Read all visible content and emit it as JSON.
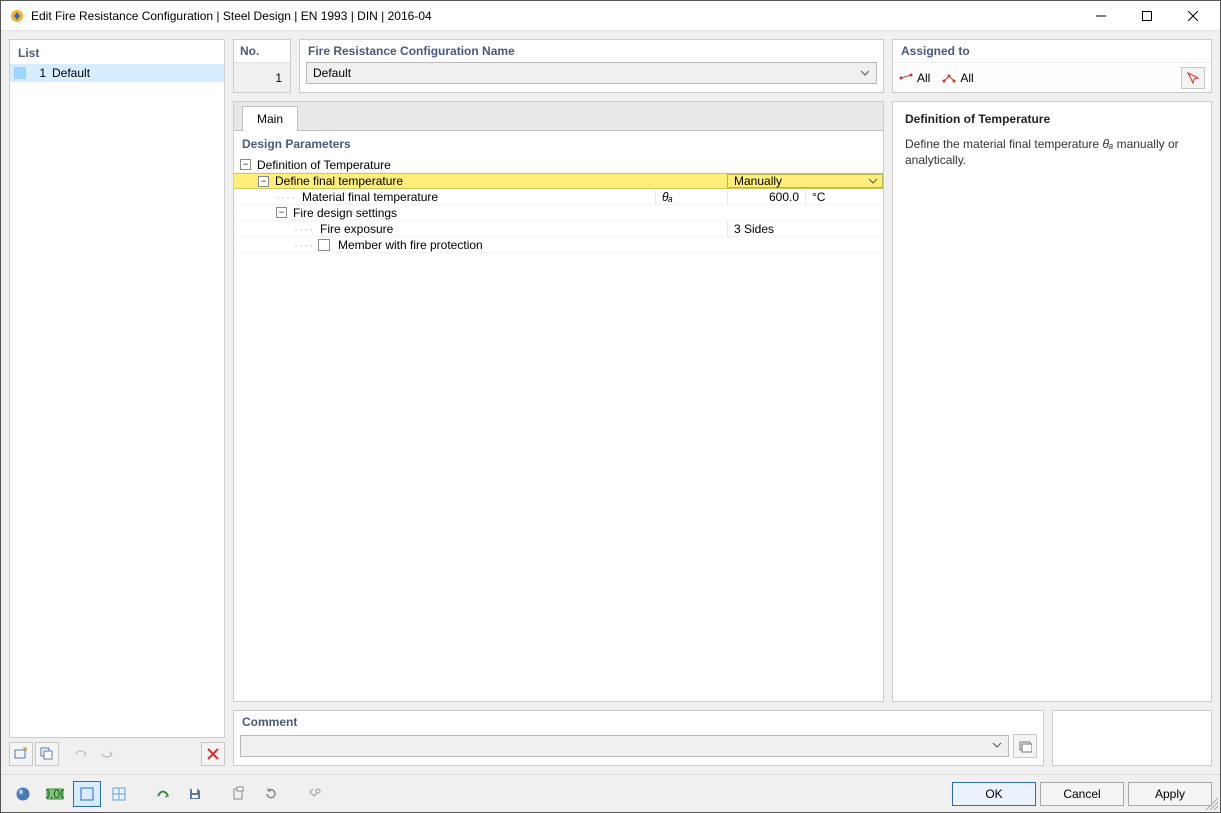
{
  "window": {
    "title": "Edit Fire Resistance Configuration | Steel Design | EN 1993 | DIN | 2016-04"
  },
  "left": {
    "header": "List",
    "items": [
      {
        "index": "1",
        "name": "Default"
      }
    ]
  },
  "top": {
    "no_header": "No.",
    "no_value": "1",
    "name_header": "Fire Resistance Configuration Name",
    "name_value": "Default",
    "assigned_header": "Assigned to",
    "assigned_all1": "All",
    "assigned_all2": "All"
  },
  "tabs": {
    "main": "Main"
  },
  "params": {
    "header": "Design Parameters",
    "rows": {
      "def_temp": "Definition of Temperature",
      "define_final": "Define final temperature",
      "define_final_value": "Manually",
      "material_final": "Material final temperature",
      "theta_symbol": "θₐ",
      "theta_value": "600.0",
      "theta_unit": "°C",
      "fire_settings": "Fire design settings",
      "fire_exposure": "Fire exposure",
      "fire_exposure_value": "3 Sides",
      "member_prot": "Member with fire protection"
    }
  },
  "help": {
    "title": "Definition of Temperature",
    "text_prefix": "Define the material final temperature ",
    "text_symbol": "θₐ",
    "text_suffix": " manually or analytically."
  },
  "comment": {
    "header": "Comment",
    "value": ""
  },
  "buttons": {
    "ok": "OK",
    "cancel": "Cancel",
    "apply": "Apply"
  }
}
